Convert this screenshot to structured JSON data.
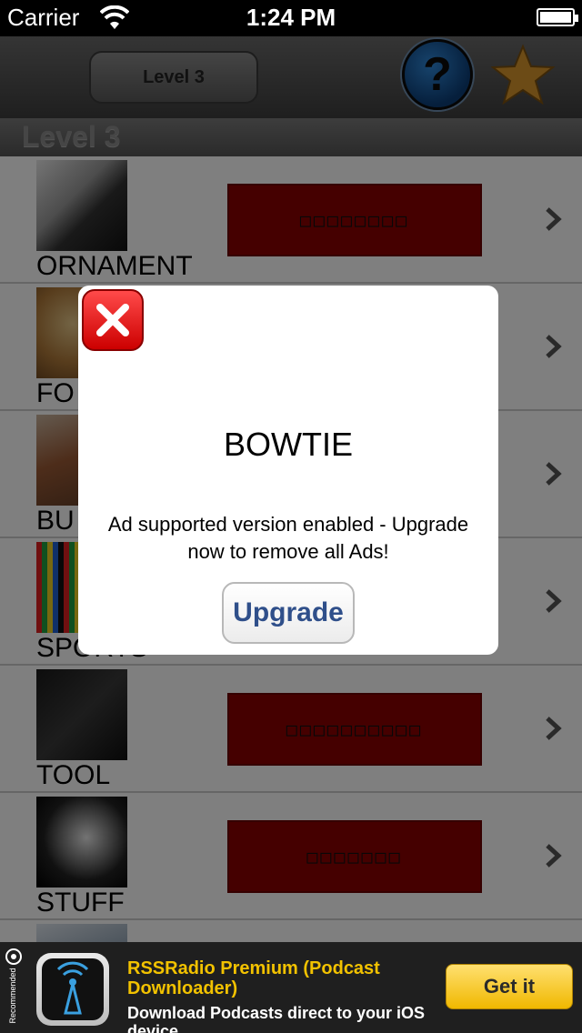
{
  "status_bar": {
    "carrier": "Carrier",
    "time": "1:24 PM"
  },
  "nav_bar": {
    "level_button_label": "Level 3",
    "help_label": "?"
  },
  "section": {
    "title": "Level 3"
  },
  "list": {
    "rows": [
      {
        "label": "ORNAMENT",
        "blank": "□□□□□□□□",
        "blank_visible": true
      },
      {
        "label": "FO",
        "blank": "",
        "blank_visible": false
      },
      {
        "label": "BU",
        "blank": "",
        "blank_visible": false
      },
      {
        "label": "SPORTS",
        "blank": "",
        "blank_visible": false
      },
      {
        "label": "TOOL",
        "blank": "□□□□□□□□□□",
        "blank_visible": true
      },
      {
        "label": "STUFF",
        "blank": "□□□□□□□",
        "blank_visible": true
      }
    ]
  },
  "dialog": {
    "title": "BOWTIE",
    "message": "Ad supported version enabled - Upgrade now to remove all Ads!",
    "upgrade_label": "Upgrade"
  },
  "ad": {
    "recommended": "Recommended",
    "title": "RSSRadio Premium (Podcast Downloader)",
    "description": "Download Podcasts direct to your iOS device.",
    "cta": "Get it"
  },
  "colors": {
    "blank_box": "#8b0000",
    "ad_title": "#f2c200",
    "upgrade_text": "#2f4f8a",
    "close_red": "#cc0000"
  },
  "icons": [
    "wifi-icon",
    "battery-icon",
    "help-icon",
    "star-icon",
    "chevron-right-icon",
    "close-icon",
    "rss-icon"
  ]
}
